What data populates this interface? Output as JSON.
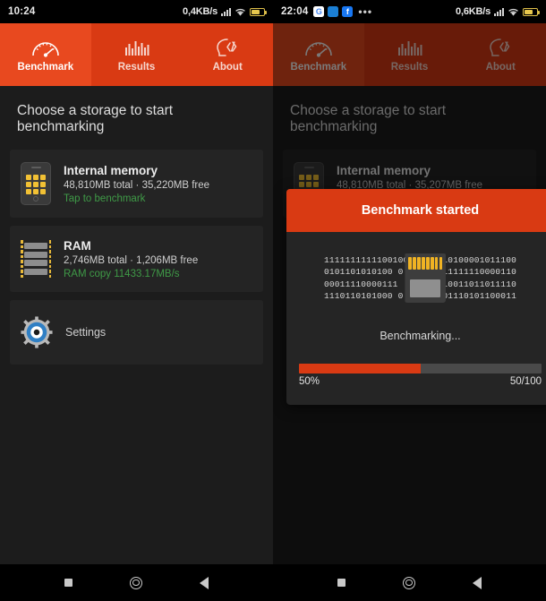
{
  "left_phone": {
    "status_bar": {
      "time": "10:24",
      "net_speed": "0,4KB/s",
      "icons": [
        "signal-bars",
        "wifi-icon",
        "battery-icon"
      ]
    },
    "tabs": [
      {
        "label": "Benchmark",
        "icon": "speedometer-icon",
        "active": true
      },
      {
        "label": "Results",
        "icon": "bar-chart-icon",
        "active": false
      },
      {
        "label": "About",
        "icon": "head-code-icon",
        "active": false
      }
    ],
    "page_title": "Choose a storage to start benchmarking",
    "cards": [
      {
        "icon": "phone-storage-icon",
        "title": "Internal memory",
        "subtitle": "48,810MB total · 35,220MB free",
        "action": "Tap to benchmark",
        "action_color": "#3f9a47"
      },
      {
        "icon": "ram-chip-icon",
        "title": "RAM",
        "subtitle": "2,746MB total · 1,206MB free",
        "action": "RAM copy 11433.17MB/s",
        "action_color": "#3f9a47"
      }
    ],
    "settings": {
      "icon": "gear-icon",
      "label": "Settings"
    }
  },
  "right_phone": {
    "status_bar": {
      "time": "22:04",
      "net_speed": "0,6KB/s",
      "app_icons": [
        "google-icon",
        "blue-app-icon",
        "facebook-icon"
      ],
      "overflow": "•••",
      "icons": [
        "signal-bars",
        "wifi-icon",
        "battery-icon"
      ]
    },
    "tabs": [
      {
        "label": "Benchmark",
        "icon": "speedometer-icon",
        "active": true
      },
      {
        "label": "Results",
        "icon": "bar-chart-icon",
        "active": false
      },
      {
        "label": "About",
        "icon": "head-code-icon",
        "active": false
      }
    ],
    "page_title": "Choose a storage to start benchmarking",
    "cards": [
      {
        "icon": "phone-storage-icon",
        "title": "Internal memory",
        "subtitle": "48,810MB total · 35,207MB free",
        "action": "Tap to benchmark",
        "action_color": "#3f9a47"
      }
    ],
    "dialog": {
      "title": "Benchmark started",
      "header_color": "#d93a13",
      "binary_left": "1111111111100100\n0101101010100 0\n00011110000111\n1110110101000 0",
      "binary_right": "10100001011100\n11111110000110\n10011011011110\n01110101100011",
      "sd_icon": "sd-card-icon",
      "status_text": "Benchmarking...",
      "progress": {
        "percent": 50,
        "percent_label": "50%",
        "count_label": "50/100",
        "fill_color": "#d93a13",
        "track_color": "#4a4a4a"
      }
    }
  },
  "nav_bar": {
    "buttons": [
      {
        "name": "recents",
        "icon": "square-icon"
      },
      {
        "name": "home",
        "icon": "circle-icon"
      },
      {
        "name": "back",
        "icon": "triangle-back-icon"
      }
    ]
  }
}
